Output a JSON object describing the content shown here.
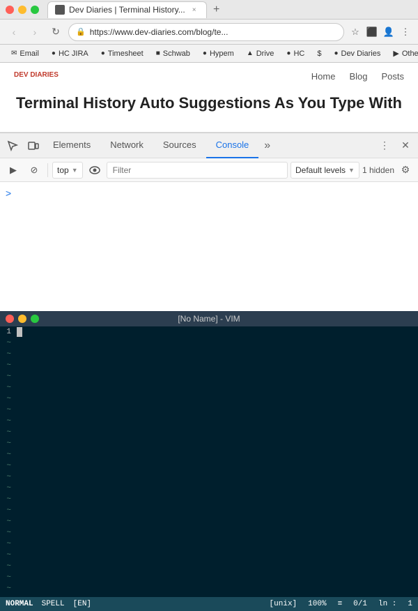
{
  "browser": {
    "tab_title": "Dev Diaries | Terminal History...",
    "tab_new_label": "+",
    "nav_back": "‹",
    "nav_forward": "›",
    "nav_refresh": "↻",
    "address": "https://www.dev-diaries.com/blog/te...",
    "address_placeholder": "https://www.dev-diaries.com/blog/te...",
    "bookmarks": [
      {
        "label": "Email",
        "icon": "✉"
      },
      {
        "label": "HC JIRA",
        "icon": "●"
      },
      {
        "label": "Timesheet",
        "icon": "●"
      },
      {
        "label": "Schwab",
        "icon": "■"
      },
      {
        "label": "Hypem",
        "icon": "●"
      },
      {
        "label": "Drive",
        "icon": "▲"
      },
      {
        "label": "HC",
        "icon": "●"
      },
      {
        "label": "$",
        "icon": ""
      },
      {
        "label": "Dev Diaries",
        "icon": "●"
      },
      {
        "label": "Other Bookmarks",
        "icon": "▶"
      }
    ]
  },
  "webpage": {
    "logo": "DEV\nDIARIES",
    "nav_items": [
      "Home",
      "Blog",
      "Posts"
    ],
    "page_title": "Terminal History Auto Suggestions As You Type With"
  },
  "devtools": {
    "tabs": [
      "Elements",
      "Network",
      "Sources",
      "Console"
    ],
    "active_tab": "Console",
    "more_label": "»",
    "tool_cursor": "⬚",
    "tool_layout": "▣",
    "tool_dots": "⋮",
    "tool_close": "✕"
  },
  "console": {
    "toolbar": {
      "play_icon": "▶",
      "ban_icon": "⊘",
      "context_label": "top",
      "context_arrow": "▼",
      "eye_icon": "👁",
      "filter_placeholder": "Filter",
      "log_level_label": "Default levels",
      "log_level_arrow": "▼",
      "hidden_count": "1 hidden",
      "settings_icon": "⚙"
    },
    "prompt": {
      "chevron": ">",
      "input_placeholder": ""
    }
  },
  "vim": {
    "title": "[No Name] - VIM",
    "line_numbers": [
      "1",
      "~",
      "~",
      "~",
      "~",
      "~",
      "~",
      "~",
      "~",
      "~",
      "~",
      "~",
      "~",
      "~",
      "~",
      "~",
      "~",
      "~",
      "~",
      "~",
      "~",
      "~",
      "~",
      "~",
      "~",
      "~",
      "~"
    ],
    "statusline": {
      "mode": "NORMAL",
      "spell": "SPELL",
      "enc": "[EN]",
      "file_format": "[unix]",
      "percent": "100%",
      "separator": "≡",
      "position": "0/1",
      "ln_label": "ln :",
      "col": "1"
    }
  }
}
